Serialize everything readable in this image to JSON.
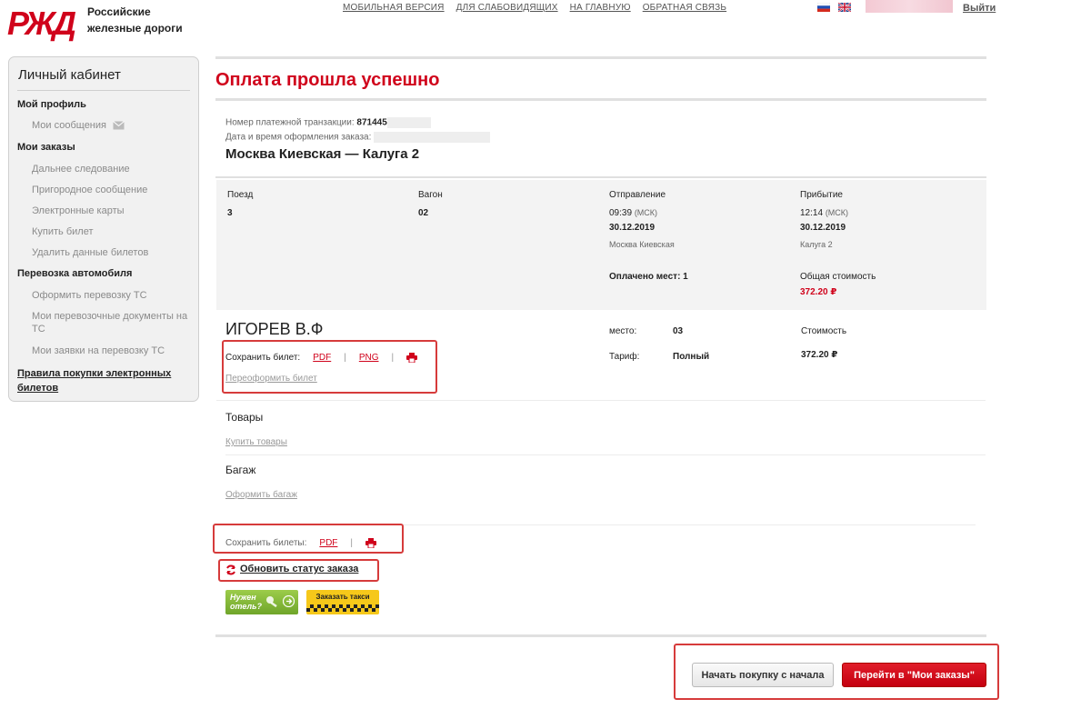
{
  "header": {
    "logo_line1": "Российские",
    "logo_line2": "железные дороги",
    "links": [
      "МОБИЛЬНАЯ ВЕРСИЯ",
      "ДЛЯ СЛАБОВИДЯЩИХ",
      "НА ГЛАВНУЮ",
      "ОБРАТНАЯ СВЯЗЬ"
    ],
    "logout": "Выйти"
  },
  "sidebar": {
    "title": "Личный кабинет",
    "profile_head": "Мой профиль",
    "messages": "Мои сообщения",
    "orders_head": "Мои заказы",
    "orders_items": [
      "Дальнее следование",
      "Пригородное сообщение",
      "Электронные карты",
      "Купить билет",
      "Удалить данные билетов"
    ],
    "car_head": "Перевозка автомобиля",
    "car_items": [
      "Оформить перевозку ТС",
      "Мои перевозочные документы на ТС",
      "Мои заявки на перевозку ТС"
    ],
    "rules_link": "Правила покупки электронных билетов"
  },
  "main": {
    "title": "Оплата прошла успешно",
    "txn_label": "Номер платежной транзакции:",
    "txn_value": "871445",
    "date_label": "Дата и время оформления заказа:",
    "route": "Москва Киевская — Калуга 2",
    "trip": {
      "train_label": "Поезд",
      "train_value": "3",
      "car_label": "Вагон",
      "car_value": "02",
      "dep_label": "Отправление",
      "dep_time": "09:39",
      "dep_tz": "(МСК)",
      "dep_date": "30.12.2019",
      "dep_station": "Москва Киевская",
      "arr_label": "Прибытие",
      "arr_time": "12:14",
      "arr_tz": "(МСК)",
      "arr_date": "30.12.2019",
      "arr_station": "Калуга 2",
      "paid_seats": "Оплачено мест: 1",
      "total_label": "Общая стоимость",
      "total_value": "372.20 ₽"
    },
    "passenger": {
      "name": "ИГОРЕВ В.Ф",
      "save_label": "Сохранить билет:",
      "pdf": "PDF",
      "png": "PNG",
      "sep": "|",
      "reissue": "Переоформить билет",
      "seat_label": "место:",
      "seat_value": "03",
      "tariff_label": "Тариф:",
      "tariff_value": "Полный",
      "cost_label": "Стоимость",
      "cost_value": "372.20 ₽"
    },
    "goods_title": "Товары",
    "goods_link": "Купить товары",
    "baggage_title": "Багаж",
    "baggage_link": "Оформить багаж",
    "save_all_label": "Сохранить билеты:",
    "save_all_pdf": "PDF",
    "refresh": "Обновить статус заказа",
    "hotel_line1": "Нужен",
    "hotel_line2": "отель?",
    "taxi": "Заказать такси",
    "btn_restart": "Начать покупку с начала",
    "btn_orders": "Перейти в \"Мои заказы\""
  },
  "colors": {
    "brand_red": "#d0021b",
    "box_red": "#d63b3b",
    "panel_gray": "#f3f3f3"
  }
}
